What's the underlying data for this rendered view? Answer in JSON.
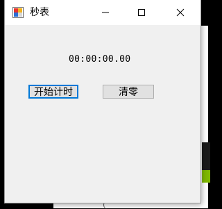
{
  "window": {
    "title": "秒表",
    "icon": "stopwatch-app-icon"
  },
  "titlebar": {
    "minimize_icon": "minimize-icon",
    "maximize_icon": "maximize-icon",
    "close_icon": "close-icon"
  },
  "main": {
    "time": "00:00:00.00",
    "start_button": "开始计时",
    "clear_button": "清零"
  },
  "colors": {
    "focus_border": "#0078d7",
    "window_bg": "#f0f0f0",
    "button_bg": "#e1e1e1"
  }
}
